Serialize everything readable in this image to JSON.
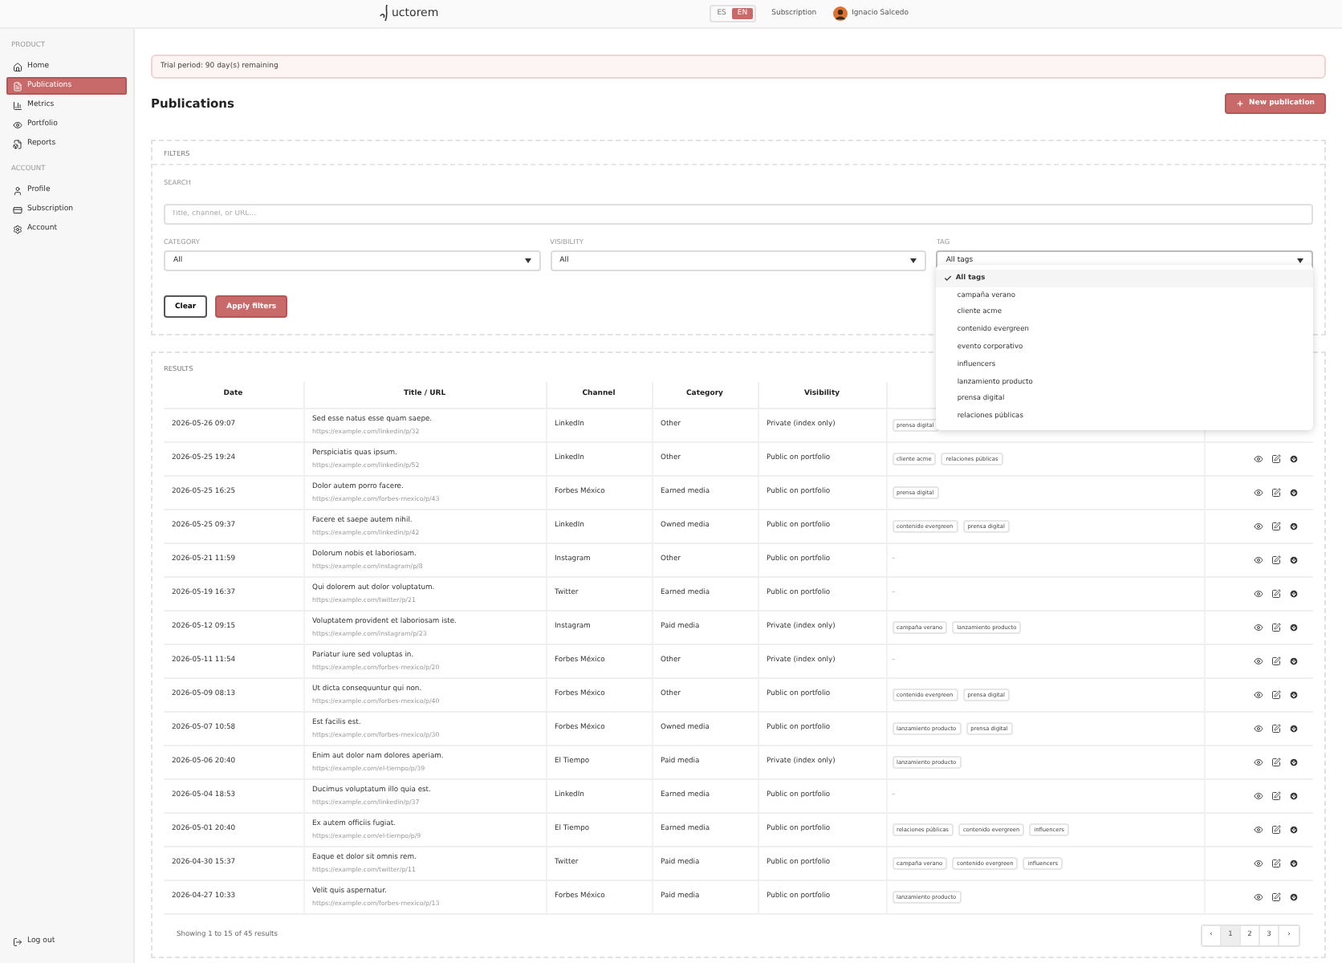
{
  "header": {
    "logo": "uctorem",
    "languages": [
      {
        "label": "ES",
        "selected": false
      },
      {
        "label": "EN",
        "selected": true
      }
    ],
    "subscription_link": "Subscription",
    "user_name": "Ignacio Salcedo"
  },
  "sidebar": {
    "sections": [
      {
        "title": "PRODUCT",
        "items": [
          {
            "label": "Home",
            "selected": false
          },
          {
            "label": "Publications",
            "selected": true
          },
          {
            "label": "Metrics",
            "selected": false
          },
          {
            "label": "Portfolio",
            "selected": false
          },
          {
            "label": "Reports",
            "selected": false
          }
        ]
      },
      {
        "title": "ACCOUNT",
        "items": [
          {
            "label": "Profile",
            "selected": false
          },
          {
            "label": "Subscription",
            "selected": false
          },
          {
            "label": "Account",
            "selected": false
          }
        ]
      }
    ],
    "logout": "Log out"
  },
  "banner": "Trial period: 90 day(s) remaining",
  "page_title": "Publications",
  "new_button": "New publication",
  "filters": {
    "title": "FILTERS",
    "search": {
      "label": "SEARCH",
      "placeholder": "Title, channel, or URL..."
    },
    "selects": [
      {
        "label": "CATEGORY",
        "value": "All"
      },
      {
        "label": "VISIBILITY",
        "value": "All"
      },
      {
        "label": "TAG",
        "value": "All tags",
        "open": true,
        "options": [
          {
            "label": "All tags",
            "selected": true
          },
          {
            "label": "campaña verano",
            "selected": false
          },
          {
            "label": "cliente acme",
            "selected": false
          },
          {
            "label": "contenido evergreen",
            "selected": false
          },
          {
            "label": "evento corporativo",
            "selected": false
          },
          {
            "label": "influencers",
            "selected": false
          },
          {
            "label": "lanzamiento producto",
            "selected": false
          },
          {
            "label": "prensa digital",
            "selected": false
          },
          {
            "label": "relaciones públicas",
            "selected": false
          }
        ]
      }
    ],
    "clear_button": "Clear",
    "apply_button": "Apply filters"
  },
  "results": {
    "title": "RESULTS",
    "columns": [
      "Date",
      "Title / URL",
      "Channel",
      "Category",
      "Visibility"
    ],
    "rows": [
      {
        "date": "2026-05-26 09:07",
        "title": "Sed esse natus esse quam saepe.",
        "url": "https://example.com/linkedin/p/32",
        "channel": "LinkedIn",
        "category": "Other",
        "visibility": "Private (index only)",
        "tags": [
          "prensa digital"
        ]
      },
      {
        "date": "2026-05-25 19:24",
        "title": "Perspiciatis quas ipsum.",
        "url": "https://example.com/linkedin/p/52",
        "channel": "LinkedIn",
        "category": "Other",
        "visibility": "Public on portfolio",
        "tags": [
          "cliente acme",
          "relaciones públicas"
        ]
      },
      {
        "date": "2026-05-25 16:25",
        "title": "Dolor autem porro facere.",
        "url": "https://example.com/forbes-mexico/p/43",
        "channel": "Forbes México",
        "category": "Earned media",
        "visibility": "Public on portfolio",
        "tags": [
          "prensa digital"
        ]
      },
      {
        "date": "2026-05-25 09:37",
        "title": "Facere et saepe autem nihil.",
        "url": "https://example.com/linkedin/p/42",
        "channel": "LinkedIn",
        "category": "Owned media",
        "visibility": "Public on portfolio",
        "tags": [
          "contenido evergreen",
          "prensa digital"
        ]
      },
      {
        "date": "2026-05-21 11:59",
        "title": "Dolorum nobis et laboriosam.",
        "url": "https://example.com/instagram/p/8",
        "channel": "Instagram",
        "category": "Other",
        "visibility": "Public on portfolio",
        "tags_empty": "–"
      },
      {
        "date": "2026-05-19 16:37",
        "title": "Qui dolorem aut dolor voluptatum.",
        "url": "https://example.com/twitter/p/21",
        "channel": "Twitter",
        "category": "Earned media",
        "visibility": "Public on portfolio",
        "tags_empty": "–"
      },
      {
        "date": "2026-05-12 09:15",
        "title": "Voluptatem provident et laboriosam iste.",
        "url": "https://example.com/instagram/p/23",
        "channel": "Instagram",
        "category": "Paid media",
        "visibility": "Private (index only)",
        "tags": [
          "campaña verano",
          "lanzamiento producto"
        ]
      },
      {
        "date": "2026-05-11 11:54",
        "title": "Pariatur iure sed voluptas in.",
        "url": "https://example.com/forbes-mexico/p/20",
        "channel": "Forbes México",
        "category": "Other",
        "visibility": "Private (index only)",
        "tags_empty": "–"
      },
      {
        "date": "2026-05-09 08:13",
        "title": "Ut dicta consequuntur qui non.",
        "url": "https://example.com/forbes-mexico/p/40",
        "channel": "Forbes México",
        "category": "Other",
        "visibility": "Public on portfolio",
        "tags": [
          "contenido evergreen",
          "prensa digital"
        ]
      },
      {
        "date": "2026-05-07 10:58",
        "title": "Est facilis est.",
        "url": "https://example.com/forbes-mexico/p/30",
        "channel": "Forbes México",
        "category": "Owned media",
        "visibility": "Public on portfolio",
        "tags": [
          "lanzamiento producto",
          "prensa digital"
        ]
      },
      {
        "date": "2026-05-06 20:40",
        "title": "Enim aut dolor nam dolores aperiam.",
        "url": "https://example.com/el-tiempo/p/39",
        "channel": "El Tiempo",
        "category": "Paid media",
        "visibility": "Private (index only)",
        "tags": [
          "lanzamiento producto"
        ]
      },
      {
        "date": "2026-05-04 18:53",
        "title": "Ducimus voluptatum illo quia est.",
        "url": "https://example.com/linkedin/p/37",
        "channel": "LinkedIn",
        "category": "Earned media",
        "visibility": "Public on portfolio",
        "tags_empty": "–"
      },
      {
        "date": "2026-05-01 20:40",
        "title": "Ex autem officiis fugiat.",
        "url": "https://example.com/el-tiempo/p/9",
        "channel": "El Tiempo",
        "category": "Earned media",
        "visibility": "Public on portfolio",
        "tags": [
          "relaciones públicas",
          "contenido evergreen",
          "influencers"
        ]
      },
      {
        "date": "2026-04-30 15:37",
        "title": "Eaque et dolor sit omnis rem.",
        "url": "https://example.com/twitter/p/11",
        "channel": "Twitter",
        "category": "Paid media",
        "visibility": "Public on portfolio",
        "tags": [
          "campaña verano",
          "contenido evergreen",
          "influencers"
        ]
      },
      {
        "date": "2026-04-27 10:33",
        "title": "Velit quis aspernatur.",
        "url": "https://example.com/forbes-mexico/p/13",
        "channel": "Forbes México",
        "category": "Paid media",
        "visibility": "Public on portfolio",
        "tags": [
          "lanzamiento producto"
        ]
      }
    ],
    "summary": "Showing 1 to 15 of 45 results",
    "pagination": {
      "prev": "‹",
      "next": "›",
      "pages": [
        {
          "label": "1",
          "selected": true
        },
        {
          "label": "2",
          "selected": false
        },
        {
          "label": "3",
          "selected": false
        }
      ]
    }
  }
}
